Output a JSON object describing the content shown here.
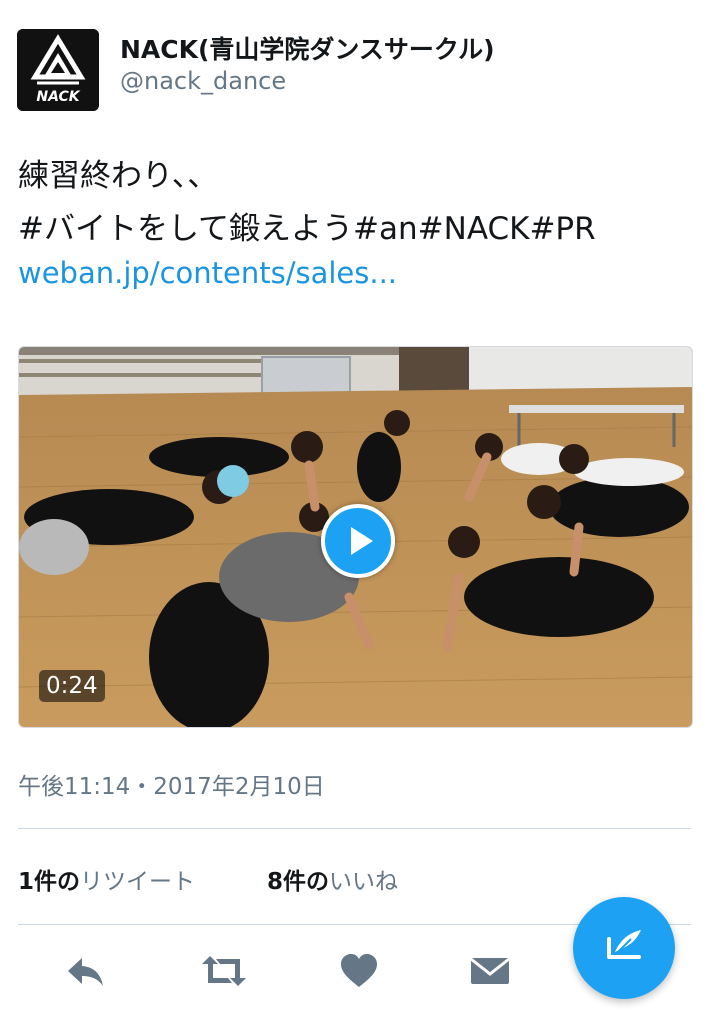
{
  "tweet": {
    "display_name": "NACK(青山学院ダンスサークル)",
    "handle": "@nack_dance",
    "avatar_text": "NACK",
    "text_line1": "練習終わり、、",
    "text_line2": "#バイトをして鍛えよう#an#NACK#PR",
    "link_text": "weban.jp/contents/sales...",
    "timestamp": "午後11:14・2017年2月10日"
  },
  "media": {
    "duration": "0:24",
    "icon": "play-icon"
  },
  "stats": {
    "retweet_count": "1件の",
    "retweet_label": "リツイート",
    "like_count": "8件の",
    "like_label": "いいね"
  },
  "actions": {
    "reply_icon": "reply-icon",
    "retweet_icon": "retweet-icon",
    "like_icon": "heart-icon",
    "dm_icon": "envelope-icon",
    "compose_icon": "compose-icon"
  },
  "colors": {
    "accent": "#1da1f2",
    "link": "#1b95e0",
    "secondary_text": "#657786",
    "action_icon": "#657786"
  }
}
